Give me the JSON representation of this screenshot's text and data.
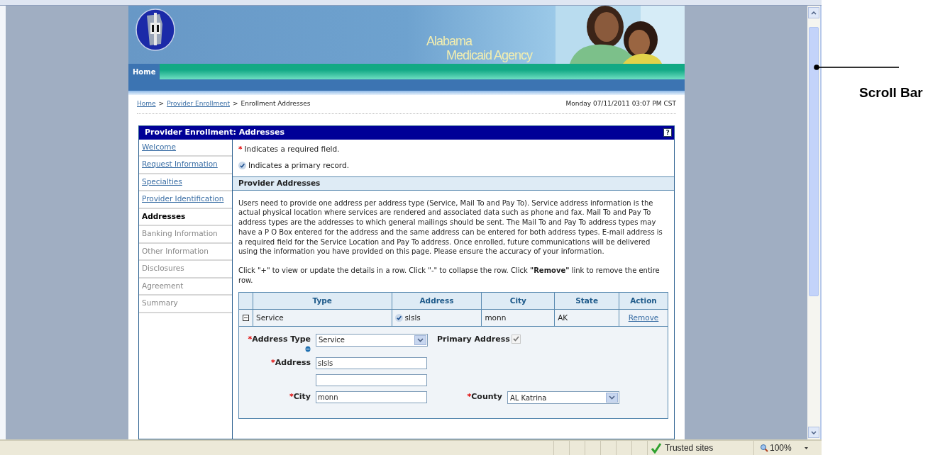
{
  "header": {
    "title_line1": "Alabama",
    "title_line2": "Medicaid Agency"
  },
  "nav": [
    {
      "label": "Home",
      "selected": true
    }
  ],
  "breadcrumb": {
    "separator": ">",
    "items": [
      {
        "label": "Home",
        "kind": "link"
      },
      {
        "label": "Provider Enrollment",
        "kind": "link"
      },
      {
        "label": "Enrollment Addresses",
        "kind": "current"
      }
    ]
  },
  "datetime": "Monday 07/11/2011 03:07 PM CST",
  "panel": {
    "title": "Provider Enrollment: Addresses",
    "help": "?"
  },
  "sidebar": [
    {
      "label": "Welcome",
      "kind": "link"
    },
    {
      "label": "Request Information",
      "kind": "link"
    },
    {
      "label": "Specialties",
      "kind": "link"
    },
    {
      "label": "Provider Identification",
      "kind": "link"
    },
    {
      "label": "Addresses",
      "kind": "current"
    },
    {
      "label": "Banking Information",
      "kind": "disabled"
    },
    {
      "label": "Other Information",
      "kind": "disabled"
    },
    {
      "label": "Disclosures",
      "kind": "disabled"
    },
    {
      "label": "Agreement",
      "kind": "disabled"
    },
    {
      "label": "Summary",
      "kind": "disabled"
    }
  ],
  "legend": [
    {
      "kind": "required",
      "marker": "*",
      "text": "Indicates a required field."
    },
    {
      "kind": "primary",
      "text": "Indicates a primary record."
    }
  ],
  "section_title": "Provider Addresses",
  "intro": "Users need to provide one address per address type (Service, Mail To and Pay To). Service address information is the actual physical location where services are rendered and associated data such as phone and fax. Mail To and Pay To address types are the addresses to which general mailings should be sent. The Mail To and Pay To address types may have a P O Box entered for the address and the same address can be entered for both address types. E-mail address is a required field for the Service Location and Pay To address. Once enrolled, future communications will be delivered using the information you have provided on this page. Please ensure the accuracy of your information.",
  "instructions": "Click \"+\" to view or update the details in a row. Click \"-\" to collapse the row. Click **\"Remove\"** link to remove the entire row.",
  "table": {
    "columns": [
      "Type",
      "Address",
      "City",
      "State",
      "Action"
    ],
    "rows": [
      {
        "expanded": true,
        "type": "Service",
        "primary": true,
        "address": "slsls",
        "city": "monn",
        "state": "AK",
        "action": "Remove"
      }
    ]
  },
  "form": {
    "required_mark": "*",
    "rows": [
      {
        "left": {
          "kind": "select",
          "label": "Address Type",
          "required": true,
          "info": true,
          "value": "Service"
        },
        "right": {
          "kind": "checkbox",
          "label": "Primary Address",
          "required": false,
          "checked": true,
          "disabled": true
        }
      },
      {
        "left": {
          "kind": "text",
          "label": "Address",
          "required": true,
          "value": "slsls"
        }
      },
      {
        "left": {
          "kind": "text"
        }
      },
      {
        "left": {
          "kind": "text",
          "label": "City",
          "required": true,
          "value": "monn"
        },
        "right": {
          "kind": "select",
          "label": "County",
          "required": true,
          "value": "AL Katrina"
        }
      }
    ]
  },
  "status_bar": {
    "zone": "Trusted sites",
    "zoom": "100%"
  },
  "annotation": {
    "label": "Scroll Bar"
  }
}
